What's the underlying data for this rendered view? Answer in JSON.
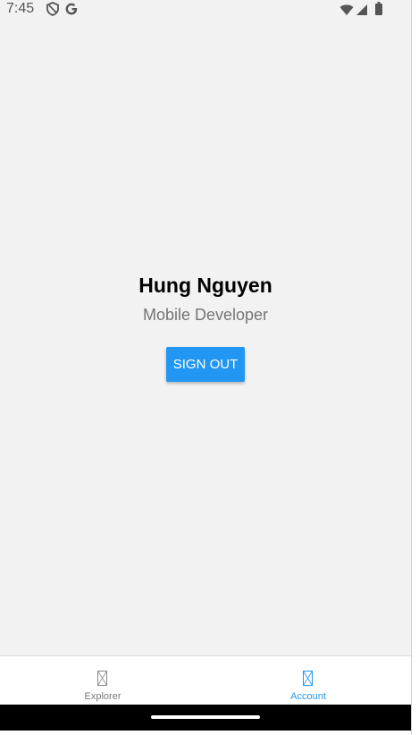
{
  "status_bar": {
    "time": "7:45",
    "left_icons": [
      "shield-icon",
      "google-icon"
    ],
    "right_icons": [
      "wifi-icon",
      "signal-icon",
      "battery-icon"
    ]
  },
  "profile": {
    "name": "Hung Nguyen",
    "role": "Mobile Developer"
  },
  "actions": {
    "sign_out_label": "SIGN OUT"
  },
  "tab_bar": {
    "tabs": [
      {
        "label": "Explorer",
        "icon": "placeholder-image-icon",
        "active": false
      },
      {
        "label": "Account",
        "icon": "placeholder-image-icon",
        "active": true
      }
    ]
  },
  "colors": {
    "background": "#f2f2f2",
    "accent": "#2196f3",
    "inactive_tab": "#7a7a7a",
    "nav_bar": "#000000"
  }
}
